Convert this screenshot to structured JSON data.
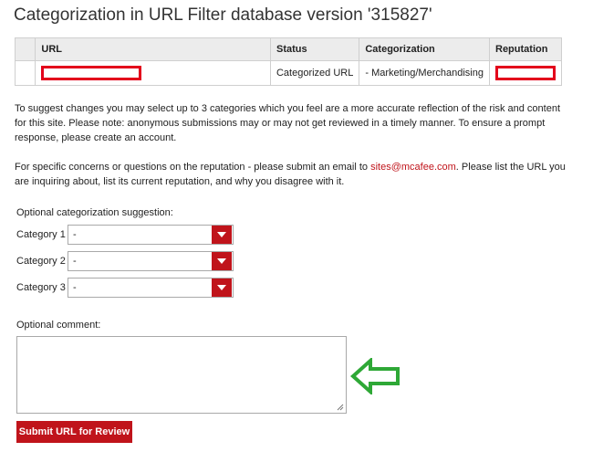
{
  "page": {
    "title": "Categorization in URL Filter database version '315827'"
  },
  "results_table": {
    "headers": [
      "",
      "URL",
      "Status",
      "Categorization",
      "Reputation"
    ],
    "row": {
      "status": "Categorized URL",
      "categorization": "- Marketing/Merchandising"
    }
  },
  "info": {
    "suggest_text": "To suggest changes you may select up to 3 categories which you feel are a more accurate reflection of the risk and content for this site. Please note: anonymous submissions may or may not get reviewed in a timely manner. To ensure a prompt response, please create an account.",
    "concerns_before": "For specific concerns or questions on the reputation - please submit an email to ",
    "concerns_email": "sites@mcafee.com",
    "concerns_after": ". Please list the URL you are inquiring about, list its current reputation, and why you disagree with it."
  },
  "form": {
    "suggestion_label": "Optional categorization suggestion:",
    "categories": [
      {
        "label": "Category 1",
        "value": "-"
      },
      {
        "label": "Category 2",
        "value": "-"
      },
      {
        "label": "Category 3",
        "value": "-"
      }
    ],
    "comment_label": "Optional comment:",
    "comment_value": "",
    "submit_label": "Submit URL for Review"
  },
  "colors": {
    "accent": "#c0141b",
    "redaction": "#e3001b",
    "annotation_arrow": "#2ea836"
  },
  "icons": {
    "dropdown": "chevron-down-icon",
    "annotation": "arrow-left-outline-icon"
  }
}
